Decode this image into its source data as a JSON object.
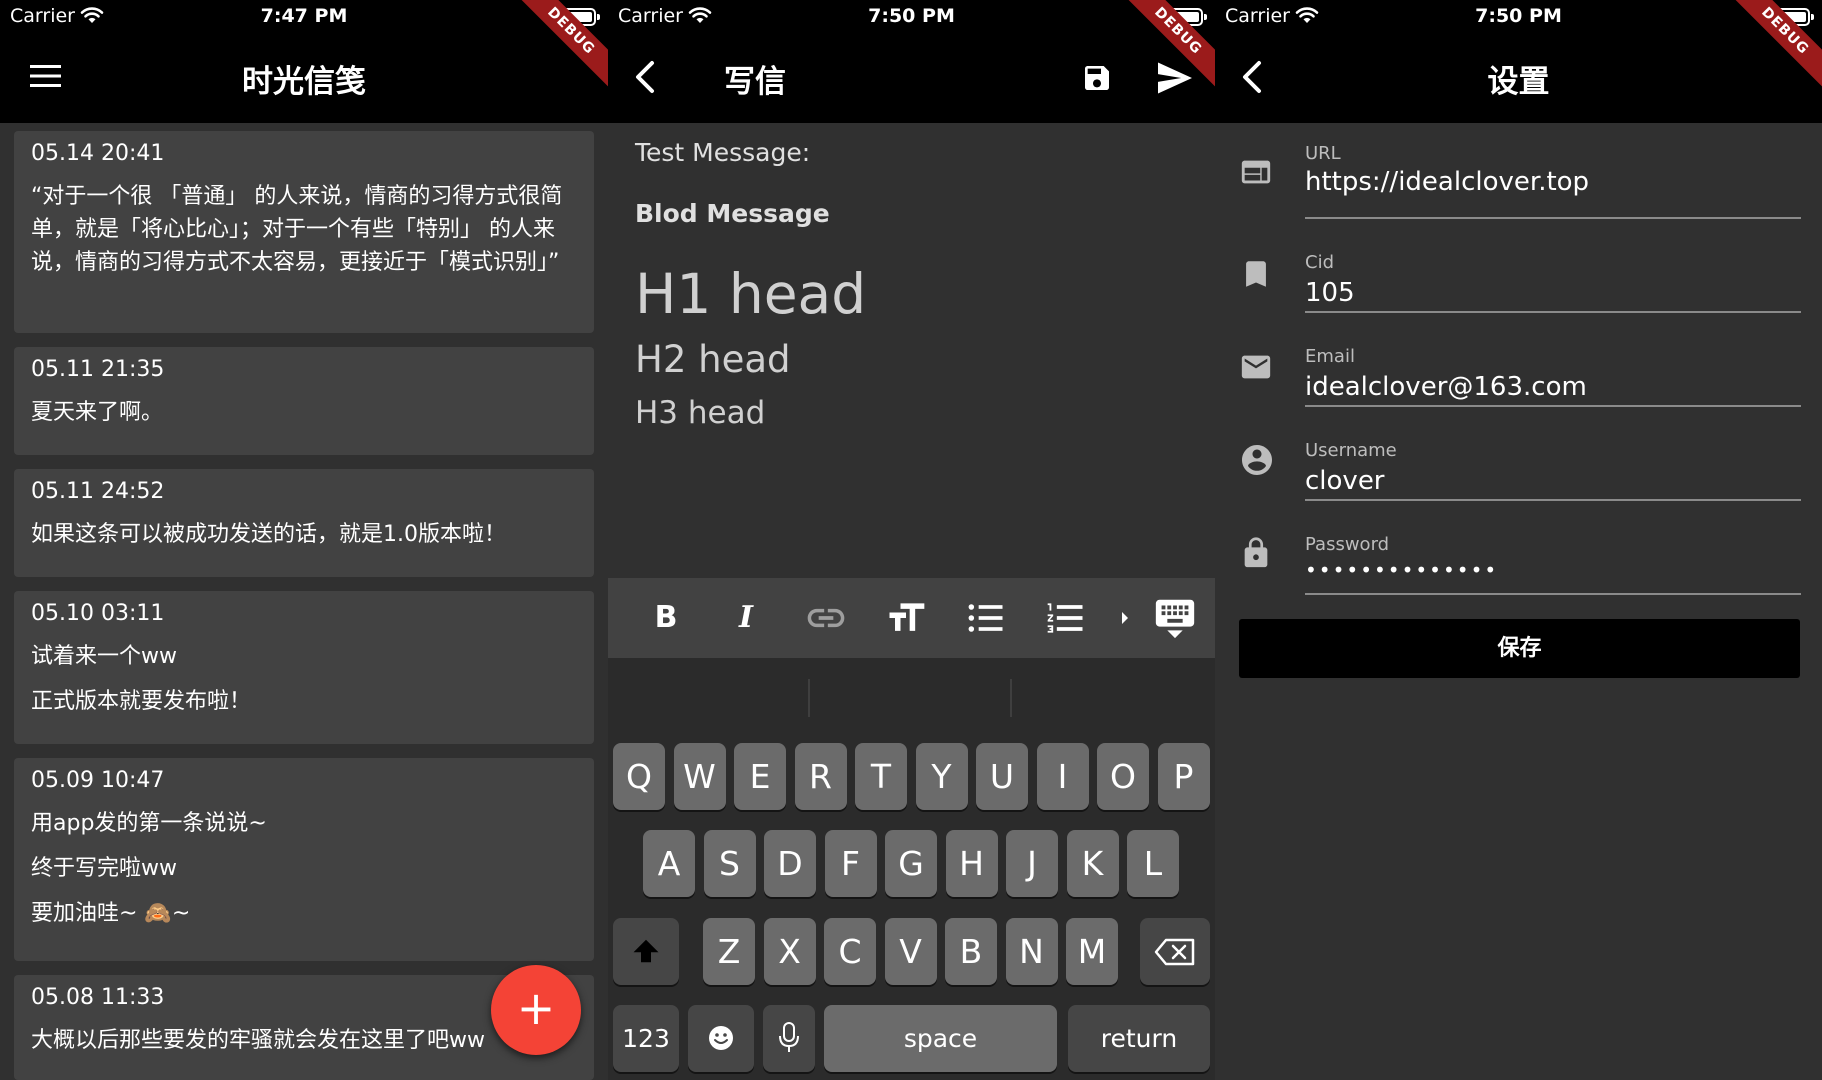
{
  "screen1": {
    "status": {
      "carrier": "Carrier",
      "time": "7:47 PM"
    },
    "debug": "DEBUG",
    "title": "时光信笺",
    "cards": [
      {
        "date": "05.14 20:41",
        "lines": [
          "“对于一个很 「普通」 的人来说，情商的习得方式很简单，就是「将心比心」；对于一个有些「特别」 的人来说，情商的习得方式不太容易，更接近于「模式识别」”"
        ]
      },
      {
        "date": "05.11 21:35",
        "lines": [
          "夏天来了啊。"
        ]
      },
      {
        "date": "05.11 24:52",
        "lines": [
          "如果这条可以被成功发送的话，就是1.0版本啦！"
        ]
      },
      {
        "date": "05.10 03:11",
        "lines": [
          "试着来一个ww",
          "正式版本就要发布啦！"
        ]
      },
      {
        "date": "05.09 10:47",
        "lines": [
          "用app发的第一条说说~",
          "终于写完啦ww",
          "要加油哇~ 🙈~"
        ]
      },
      {
        "date": "05.08 11:33",
        "lines": [
          "大概以后那些要发的牢骚就会发在这里了吧ww"
        ]
      }
    ],
    "fab_label": "+"
  },
  "screen2": {
    "status": {
      "carrier": "Carrier",
      "time": "7:50 PM"
    },
    "debug": "DEBUG",
    "title": "写信",
    "editor": {
      "p1": "Test Message:",
      "p2": "Blod Message",
      "h1": "H1 head",
      "h2": "H2 head",
      "h3": "H3 head"
    },
    "toolbar": {
      "bold": "B",
      "italic": "I"
    },
    "keyboard": {
      "row1": [
        "Q",
        "W",
        "E",
        "R",
        "T",
        "Y",
        "U",
        "I",
        "O",
        "P"
      ],
      "row2": [
        "A",
        "S",
        "D",
        "F",
        "G",
        "H",
        "J",
        "K",
        "L"
      ],
      "row3": [
        "Z",
        "X",
        "C",
        "V",
        "B",
        "N",
        "M"
      ],
      "numbers": "123",
      "space": "space",
      "return": "return"
    }
  },
  "screen3": {
    "status": {
      "carrier": "Carrier",
      "time": "7:50 PM"
    },
    "debug": "DEBUG",
    "title": "设置",
    "fields": [
      {
        "label": "URL",
        "value": "https://idealclover.top"
      },
      {
        "label": "Cid",
        "value": "105"
      },
      {
        "label": "Email",
        "value": "idealclover@163.com"
      },
      {
        "label": "Username",
        "value": "clover"
      },
      {
        "label": "Password",
        "value": "••••••••••••••"
      }
    ],
    "save_label": "保存"
  }
}
